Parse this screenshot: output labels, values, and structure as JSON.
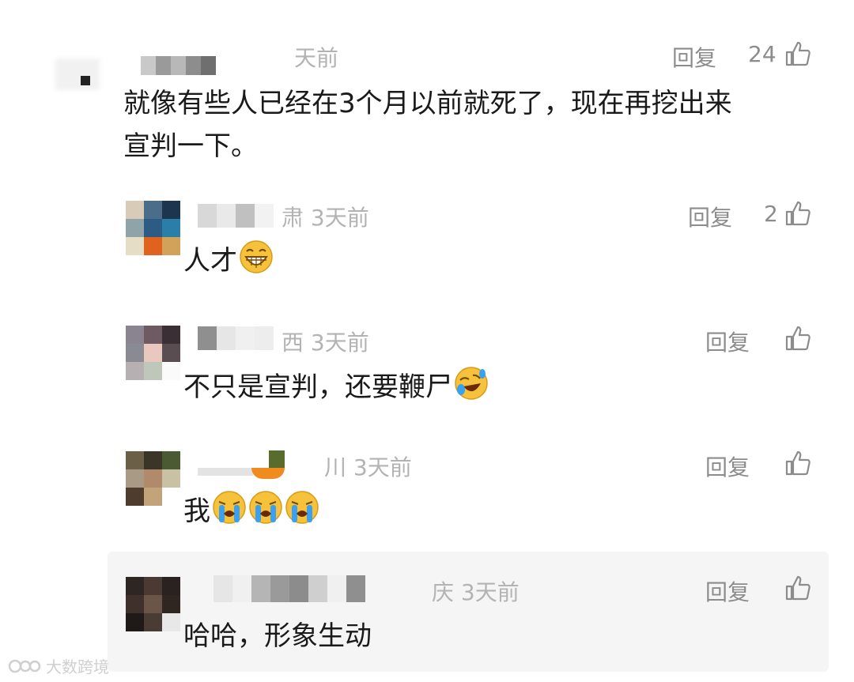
{
  "comments": [
    {
      "meta": "天前",
      "reply_label": "回复",
      "likes": "24",
      "content_line1": "就像有些人已经在3个月以前就死了，现在再挖出来",
      "content_line2": "宣判一下。",
      "like_icon": "thumbs-up-icon"
    }
  ],
  "replies": [
    {
      "meta": "肃 3天前",
      "reply_label": "回复",
      "likes": "2",
      "content": "人才",
      "emoji": "grinning-face-icon"
    },
    {
      "meta": "西 3天前",
      "reply_label": "回复",
      "likes": "",
      "content": "不只是宣判，还要鞭尸",
      "emoji": "rolling-laughing-icon"
    },
    {
      "meta": "川 3天前",
      "reply_label": "回复",
      "likes": "",
      "content": "我",
      "emoji": "loudly-crying-icon"
    },
    {
      "meta": "庆 3天前",
      "reply_label": "回复",
      "likes": "",
      "content": "哈哈，形象生动",
      "emoji": ""
    }
  ],
  "watermark": {
    "text": "大数跨境",
    "icon": "brand-logo-icon"
  }
}
